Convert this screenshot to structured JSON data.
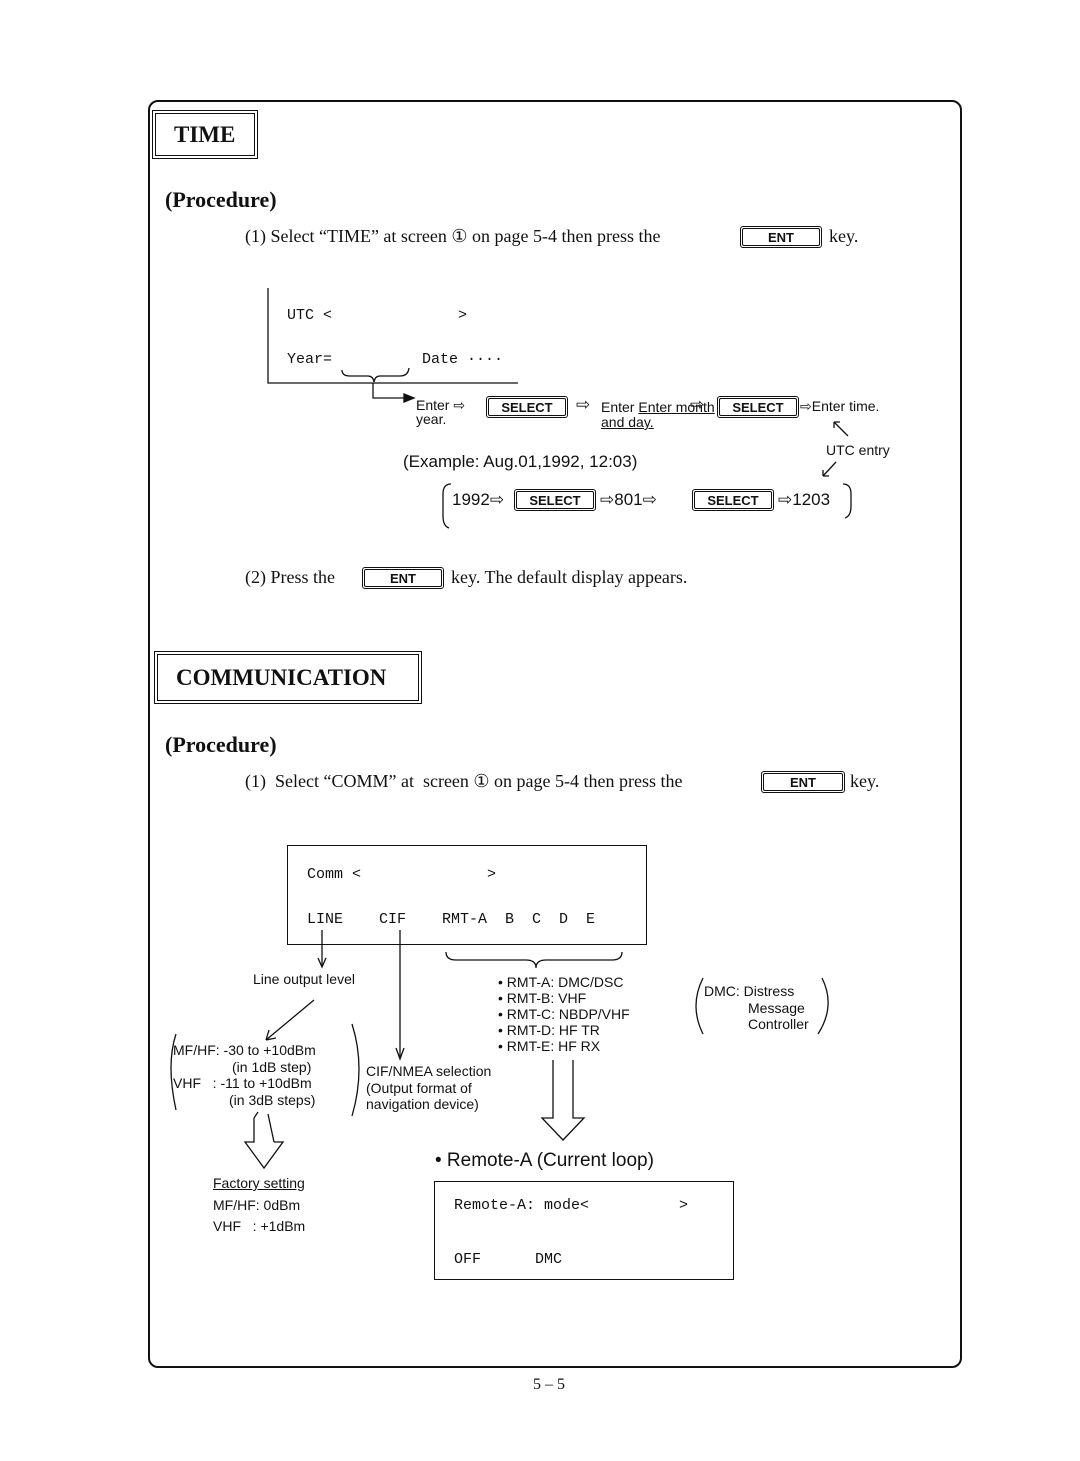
{
  "time_section": {
    "heading": "TIME",
    "procedure_label": "(Procedure)",
    "step1": {
      "prefix": "(1)  Select “TIME” at screen ① on page 5-4 then press the",
      "key": "ENT",
      "suffix": "key."
    },
    "display": {
      "line1": "UTC <              >",
      "line2": "Year=          Date ····"
    },
    "flow": {
      "enter_year": "Enter ⇨",
      "enter_year_2": "year.",
      "select_key": "SELECT",
      "arrow": "⇨",
      "enter_month": "Enter month",
      "enter_month_2": "and day.",
      "enter_time": "⇨Enter time.",
      "utc_entry": "UTC entry"
    },
    "example": {
      "label": "(Example: Aug.01,1992, 12:03)",
      "year": "1992⇨",
      "mid": "⇨801⇨",
      "end": "⇨1203"
    },
    "step2": {
      "prefix": "(2)  Press the",
      "key": "ENT",
      "suffix": "key. The default display appears."
    }
  },
  "comm_section": {
    "heading": "COMMUNICATION",
    "procedure_label": "(Procedure)",
    "step1": {
      "prefix": "(1)  Select “COMM” at  screen ① on page 5-4 then press the",
      "key": "ENT",
      "suffix": "key."
    },
    "display": {
      "line1": "Comm <              >",
      "line2": "LINE    CIF    RMT-A  B  C  D  E"
    },
    "line_output_label": "Line output level",
    "line_ranges": [
      "MF/HF: -30 to +10dBm",
      "(in 1dB step)",
      "VHF   : -11 to +10dBm",
      "(in 3dB steps)"
    ],
    "cif_desc": [
      "CIF/NMEA selection",
      "(Output format of",
      "navigation device)"
    ],
    "rmt_list": [
      "• RMT-A: DMC/DSC",
      "• RMT-B: VHF",
      "• RMT-C: NBDP/VHF",
      "• RMT-D: HF TR",
      "• RMT-E: HF RX"
    ],
    "dmc_note": [
      "DMC: Distress",
      "Message",
      "Controller"
    ],
    "factory": {
      "title": "Factory setting",
      "mfhf": "MF/HF: 0dBm",
      "vhf": "VHF   : +1dBm"
    },
    "remote_title": "• Remote-A (Current loop)",
    "remote_display": {
      "line1": "Remote-A: mode<          >",
      "line2": "OFF      DMC"
    }
  },
  "page_number": "5 – 5"
}
